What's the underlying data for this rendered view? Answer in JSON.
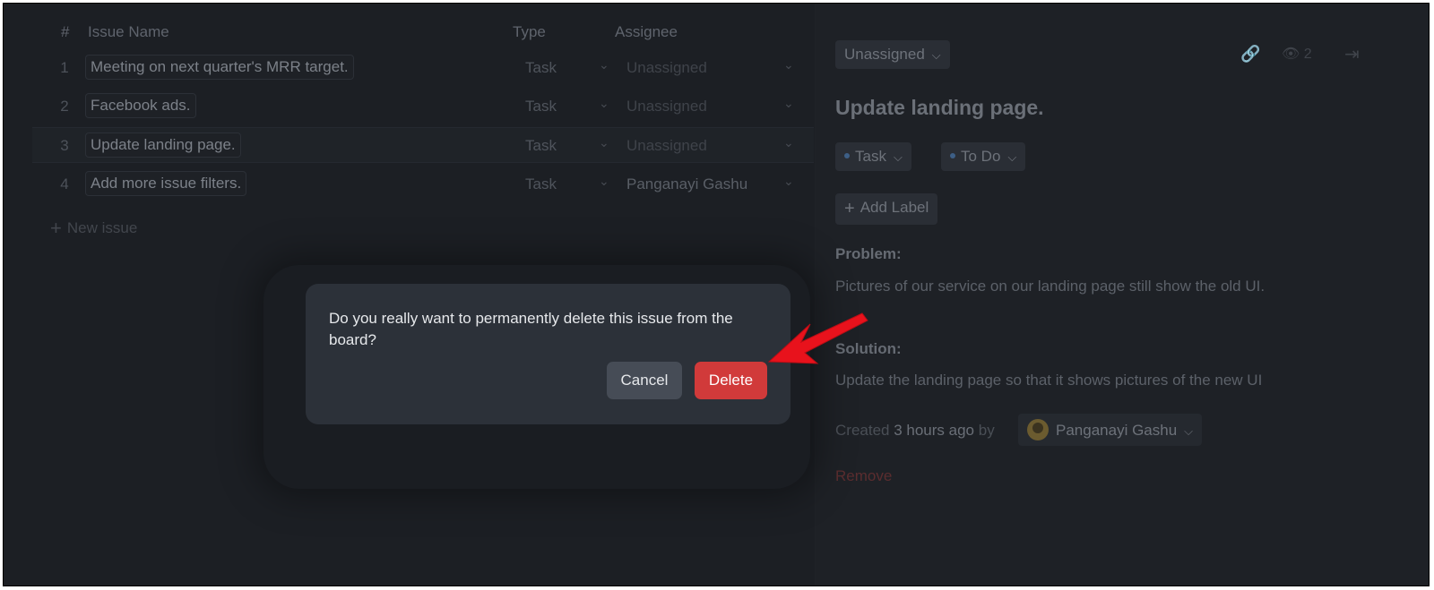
{
  "table": {
    "headers": {
      "num": "#",
      "name": "Issue Name",
      "type": "Type",
      "assignee": "Assignee"
    },
    "rows": [
      {
        "num": "1",
        "name": "Meeting on next quarter's MRR target.",
        "type": "Task",
        "assignee": "Unassigned"
      },
      {
        "num": "2",
        "name": "Facebook ads.",
        "type": "Task",
        "assignee": "Unassigned"
      },
      {
        "num": "3",
        "name": "Update landing page.",
        "type": "Task",
        "assignee": "Unassigned"
      },
      {
        "num": "4",
        "name": "Add more issue filters.",
        "type": "Task",
        "assignee": "Panganayi Gashu"
      }
    ],
    "new_issue_label": "New issue"
  },
  "detail": {
    "assignee_select": "Unassigned",
    "watchers_count": "2",
    "title": "Update landing page.",
    "type_chip": "Task",
    "status_chip": "To Do",
    "add_label": "Add Label",
    "problem_label": "Problem:",
    "problem_text": "Pictures of our service on our landing page still show the old UI.",
    "solution_label": "Solution:",
    "solution_text": "Update the landing page so that it shows pictures of the new UI",
    "created_prefix": "Created",
    "created_time": "3 hours ago",
    "created_by": "by",
    "author": "Panganayi Gashu",
    "remove_label": "Remove"
  },
  "modal": {
    "message": "Do you really want to permanently delete this issue from the board?",
    "cancel_label": "Cancel",
    "delete_label": "Delete"
  },
  "colors": {
    "delete_button": "#d13a3a",
    "annotation_arrow": "#e8121c"
  }
}
